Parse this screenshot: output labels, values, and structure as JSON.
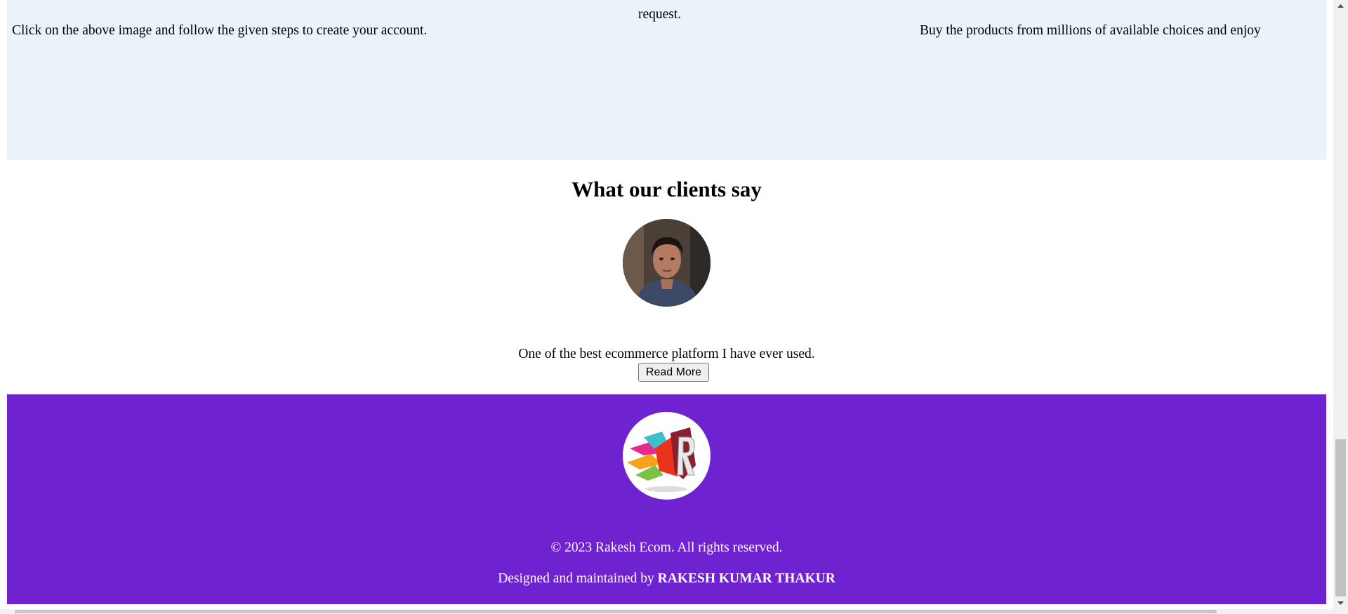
{
  "steps": {
    "left_text": "Click on the above image and follow the given steps to create your account.",
    "middle_text": "request.",
    "right_text": "Buy the products from millions of available choices and enjoy"
  },
  "clients": {
    "heading": "What our clients say",
    "quote": "One of the best ecommerce platform I have ever used.",
    "read_more_label": "Read More"
  },
  "footer": {
    "logo_letter": "R",
    "copyright": "© 2023 Rakesh Ecom. All rights reserved.",
    "designed_prefix": "Designed and maintained by ",
    "designer_name": "RAKESH KUMAR THAKUR"
  },
  "colors": {
    "steps_background": "#ebf3fa",
    "footer_background": "#6f22cf",
    "footer_text": "#ffffff"
  },
  "icons": {
    "scroll_up": "triangle-up-icon",
    "scroll_down": "triangle-down-icon"
  }
}
